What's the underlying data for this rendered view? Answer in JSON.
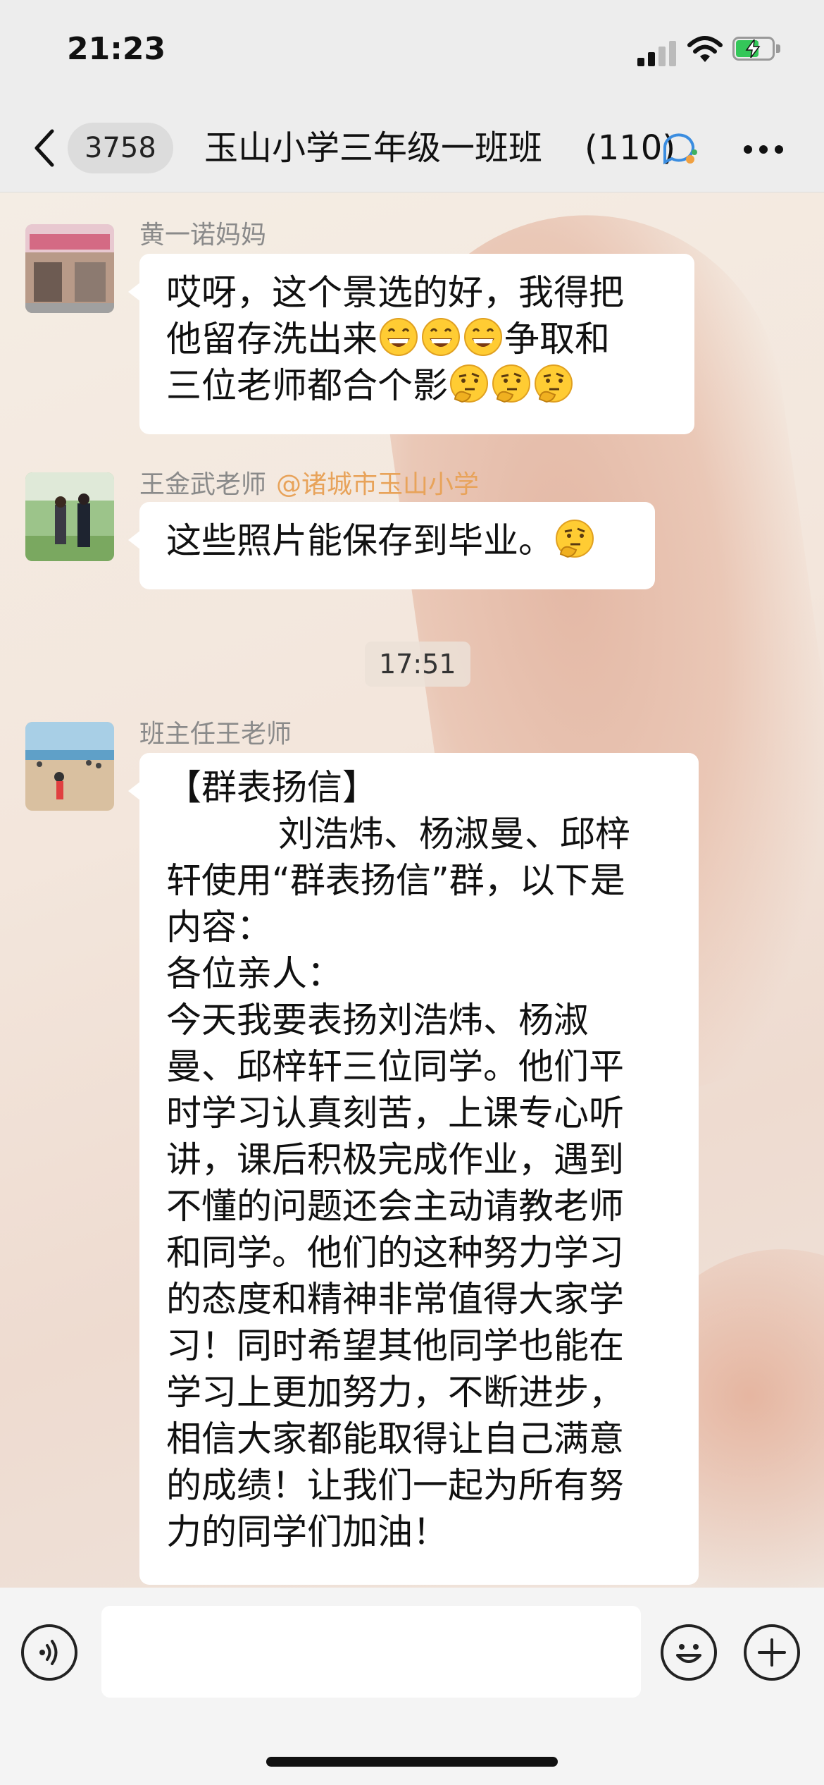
{
  "status_bar": {
    "time": "21:23"
  },
  "nav": {
    "back_badge": "3758",
    "title": "玉山小学三年级一班班",
    "member_count": "(110)"
  },
  "messages": [
    {
      "sender": "黄一诺妈妈",
      "sender_tag": "",
      "lines": [
        "哎呀，这个景选的好，我得把",
        "他留存洗出来",
        "争取和",
        "三位老师都合个影"
      ]
    },
    {
      "sender": "王金武老师",
      "sender_tag": "@诸城市玉山小学",
      "lines": [
        "这些照片能保存到毕业。"
      ]
    },
    {
      "sender": "班主任王老师",
      "sender_tag": "",
      "lines": [
        "【群表扬信】",
        "          刘浩炜、杨淑曼、邱梓",
        "轩使用“群表扬信”群，以下是",
        "内容：",
        "各位亲人：",
        "今天我要表扬刘浩炜、杨淑",
        "曼、邱梓轩三位同学。他们平",
        "时学习认真刻苦，上课专心听",
        "讲，课后积极完成作业，遇到",
        "不懂的问题还会主动请教老师",
        "和同学。他们的这种努力学习",
        "的态度和精神非常值得大家学",
        "习！同时希望其他同学也能在",
        "学习上更加努力，不断进步，",
        "相信大家都能取得让自己满意",
        "的成绩！让我们一起为所有努",
        "力的同学们加油！"
      ]
    }
  ],
  "timestamp": "17:51",
  "input": {
    "placeholder": ""
  },
  "icons": {
    "grin": "grinning-face-icon",
    "think": "thinking-face-icon"
  },
  "colors": {
    "mention": "#e8a35a",
    "battery": "#34c759",
    "sender": "#8a8a8a"
  }
}
